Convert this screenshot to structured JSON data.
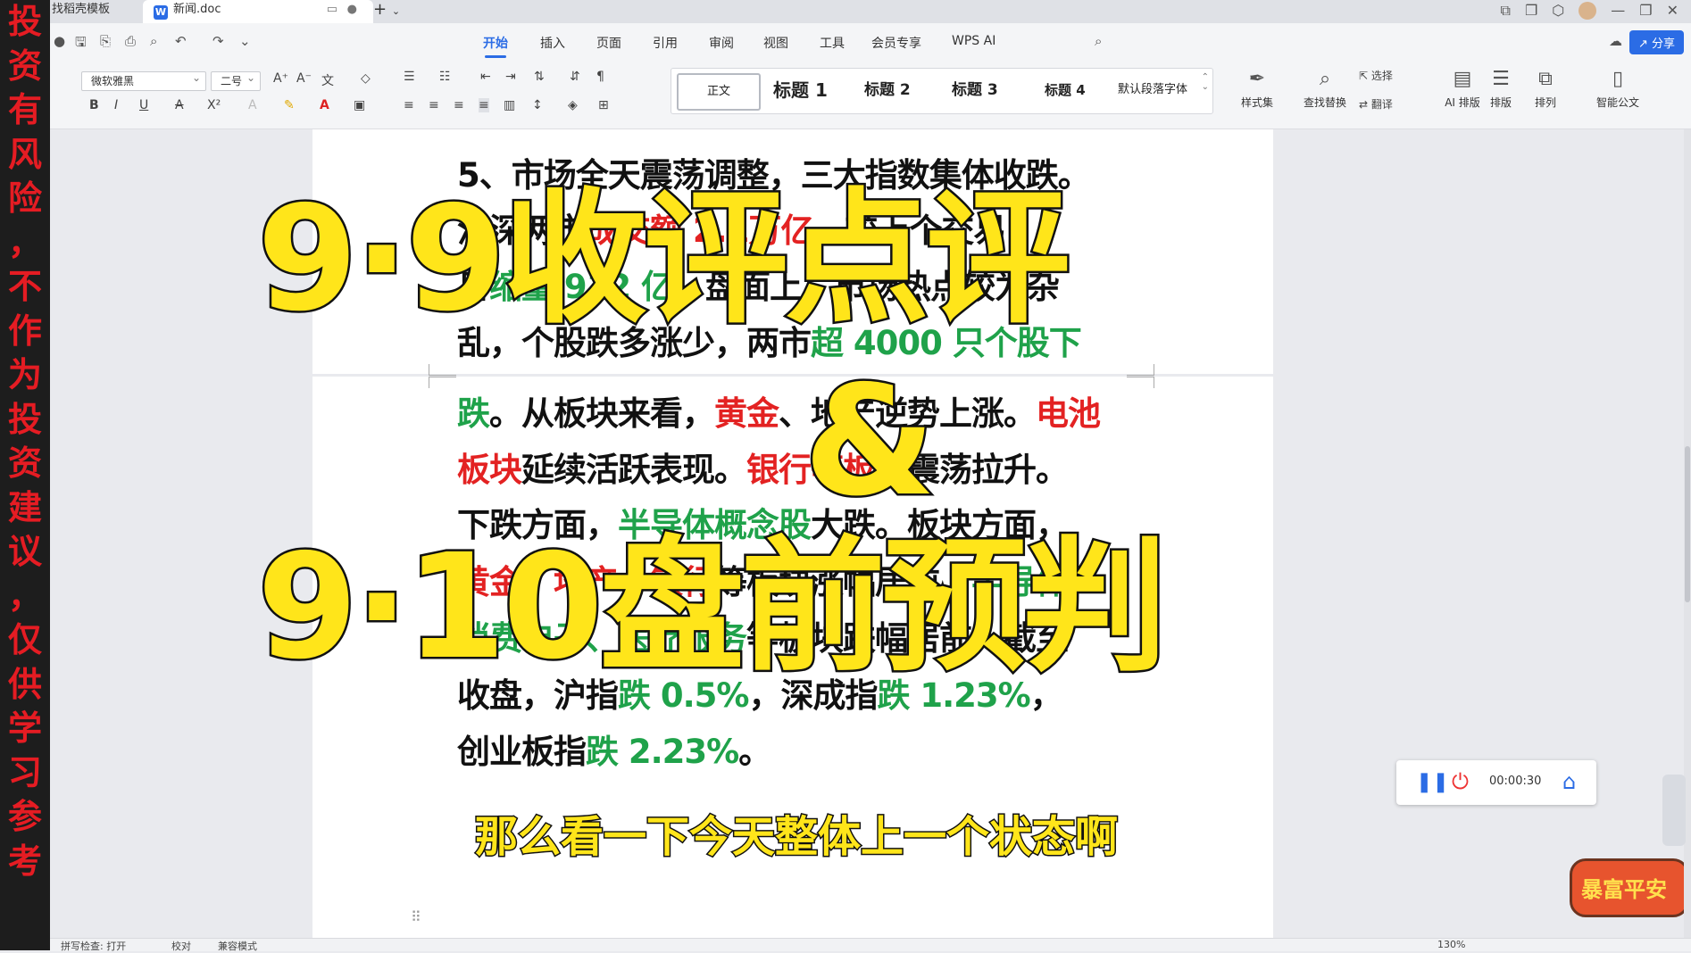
{
  "warning": [
    "投",
    "资",
    "有",
    "风",
    "险",
    "，",
    "不",
    "作",
    "为",
    "投",
    "资",
    "建",
    "议",
    "，",
    "仅",
    "供",
    "学",
    "习",
    "参",
    "考"
  ],
  "tabs": {
    "template_tab": "找稻壳模板",
    "doc_tab": "新闻.doc",
    "doc_icon": "W",
    "new_tab": "+"
  },
  "menu": [
    {
      "label": "开始",
      "active": true
    },
    {
      "label": "插入"
    },
    {
      "label": "页面"
    },
    {
      "label": "引用"
    },
    {
      "label": "审阅"
    },
    {
      "label": "视图"
    },
    {
      "label": "工具"
    },
    {
      "label": "会员专享"
    },
    {
      "label": "WPS AI"
    }
  ],
  "share_label": "分享",
  "ribbon": {
    "font_name": "微软雅黑",
    "font_size": "二号",
    "styles": [
      "正文",
      "标题 1",
      "标题 2",
      "标题 3",
      "标题 4",
      "默认段落字体"
    ],
    "styles_set": "样式集",
    "find_replace": "查找替换",
    "select": "选择",
    "translate": "翻译",
    "ai_layout": "AI 排版",
    "layout": "排版",
    "arrange": "排列",
    "smart_doc": "智能公文"
  },
  "doc": {
    "lines": [
      [
        {
          "t": "5、市场全天震荡调整，三大指数集体收跌。",
          "c": ""
        }
      ],
      [
        {
          "t": "沪深两市",
          "c": ""
        },
        {
          "t": "成交额 2.1万亿",
          "c": "r"
        },
        {
          "t": "，较上个交易",
          "c": ""
        }
      ],
      [
        {
          "t": "日",
          "c": ""
        },
        {
          "t": "缩量 912 亿",
          "c": "g"
        },
        {
          "t": "。盘面上，市场热点较为杂",
          "c": ""
        }
      ],
      [
        {
          "t": "乱，个股跌多涨少，两市",
          "c": ""
        },
        {
          "t": "超 4000 只个股下",
          "c": "g"
        }
      ],
      [
        {
          "t": "跌",
          "c": "g"
        },
        {
          "t": "。从板块来看，",
          "c": ""
        },
        {
          "t": "黄金",
          "c": "r"
        },
        {
          "t": "、地产逆势上涨。",
          "c": ""
        },
        {
          "t": "电池",
          "c": "r"
        }
      ],
      [
        {
          "t": "板块",
          "c": "r"
        },
        {
          "t": "延续活跃表现。",
          "c": ""
        },
        {
          "t": "银行等板块",
          "c": "r"
        },
        {
          "t": "震荡拉升。",
          "c": ""
        }
      ],
      [
        {
          "t": "下跌方面，",
          "c": ""
        },
        {
          "t": "半导体概念股",
          "c": "g"
        },
        {
          "t": "大跌。板块方面，",
          "c": ""
        }
      ],
      [
        {
          "t": "黄金、地产、银行",
          "c": "r"
        },
        {
          "t": "等板块涨幅居前，",
          "c": ""
        },
        {
          "t": "半导体",
          "c": "g"
        }
      ],
      [
        {
          "t": "消费电子、医疗服务",
          "c": "g"
        },
        {
          "t": "等板块跌幅居前。截至",
          "c": ""
        }
      ],
      [
        {
          "t": "收盘，沪指",
          "c": ""
        },
        {
          "t": "跌 0.5%",
          "c": "g"
        },
        {
          "t": "，深成指",
          "c": ""
        },
        {
          "t": "跌 1.23%",
          "c": "g"
        },
        {
          "t": "，",
          "c": ""
        }
      ],
      [
        {
          "t": "创业板指",
          "c": ""
        },
        {
          "t": "跌 2.23%",
          "c": "g"
        },
        {
          "t": "。",
          "c": ""
        }
      ]
    ]
  },
  "overlay": {
    "title1": "9·9收评点评",
    "amp": "&",
    "title2": "9·10盘前预判",
    "subtitle": "那么看一下今天整体上一个状态啊"
  },
  "recorder": {
    "time": "00:00:30"
  },
  "badge": "暴富平安",
  "status": {
    "spell": "拼写检查: 打开",
    "proof": "校对",
    "compat": "兼容模式",
    "zoom": "130%"
  }
}
